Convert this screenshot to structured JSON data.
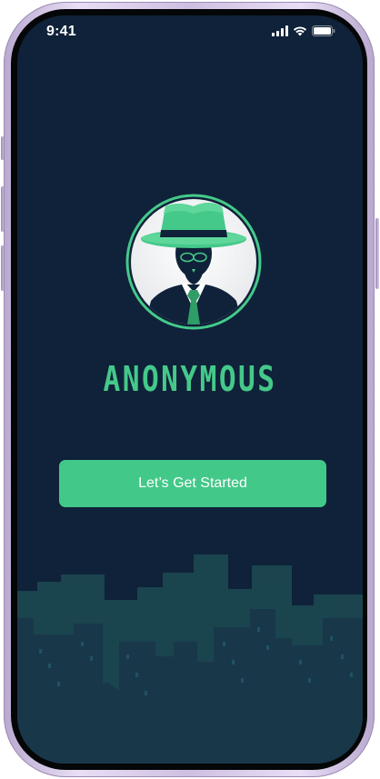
{
  "status_bar": {
    "time": "9:41",
    "icons": [
      "cellular-signal-icon",
      "wifi-icon",
      "battery-icon"
    ]
  },
  "logo": {
    "icon": "spy-agent-fedora-icon",
    "colors": {
      "accent": "#45c98a",
      "dark": "#0f2239"
    }
  },
  "brand": {
    "name": "ANONYMOUS"
  },
  "cta": {
    "label": "Let’s Get Started"
  },
  "colors": {
    "background": "#0f2239",
    "accent": "#42c888",
    "button_text": "#ffffff"
  }
}
